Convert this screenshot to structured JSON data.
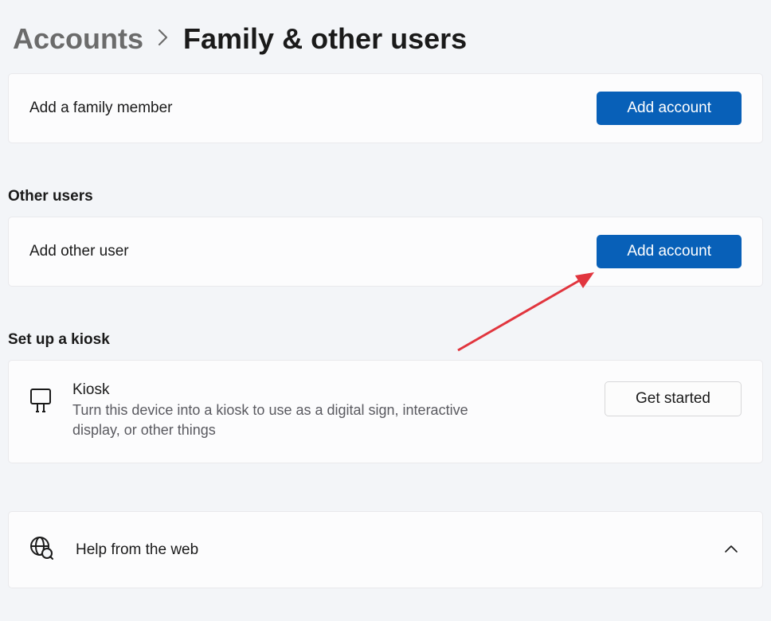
{
  "breadcrumb": {
    "parent": "Accounts",
    "current": "Family & other users"
  },
  "family": {
    "add_member_label": "Add a family member",
    "add_button_label": "Add account"
  },
  "other_users": {
    "header": "Other users",
    "add_other_label": "Add other user",
    "add_button_label": "Add account"
  },
  "kiosk": {
    "header": "Set up a kiosk",
    "title": "Kiosk",
    "description": "Turn this device into a kiosk to use as a digital sign, interactive display, or other things",
    "button_label": "Get started"
  },
  "help": {
    "label": "Help from the web"
  },
  "colors": {
    "accent": "#0860b8"
  }
}
